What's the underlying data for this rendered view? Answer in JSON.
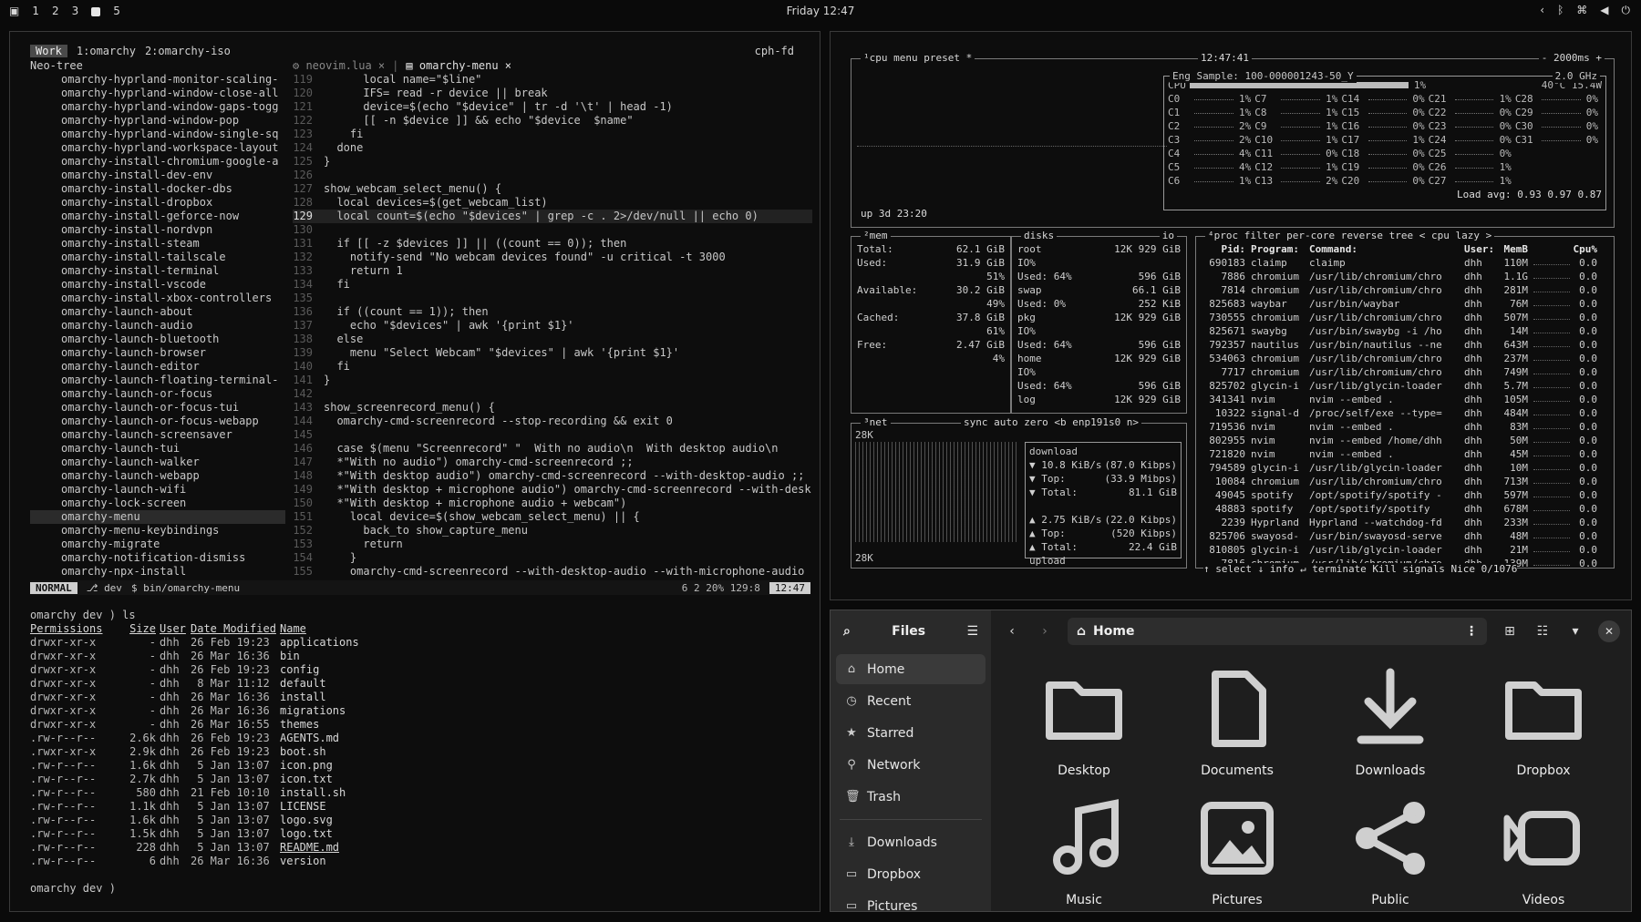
{
  "topbar": {
    "workspaces": [
      "1",
      "2",
      "3",
      "5"
    ],
    "active_workspace": "4",
    "clock": "Friday 12:47",
    "tray_icons": [
      "chevron-left-icon",
      "bluetooth-icon",
      "network-icon",
      "volume-icon",
      "power-icon"
    ]
  },
  "nvim": {
    "session_label": "Work",
    "tmux_windows": [
      "1:omarchy",
      "2:omarchy-iso"
    ],
    "host": "cph-fd",
    "tree_title": "Neo-tree",
    "tree_items": [
      "omarchy-hyprland-monitor-scaling-",
      "omarchy-hyprland-window-close-all",
      "omarchy-hyprland-window-gaps-togg",
      "omarchy-hyprland-window-pop",
      "omarchy-hyprland-window-single-sq",
      "omarchy-hyprland-workspace-layout",
      "omarchy-install-chromium-google-a",
      "omarchy-install-dev-env",
      "omarchy-install-docker-dbs",
      "omarchy-install-dropbox",
      "omarchy-install-geforce-now",
      "omarchy-install-nordvpn",
      "omarchy-install-steam",
      "omarchy-install-tailscale",
      "omarchy-install-terminal",
      "omarchy-install-vscode",
      "omarchy-install-xbox-controllers",
      "omarchy-launch-about",
      "omarchy-launch-audio",
      "omarchy-launch-bluetooth",
      "omarchy-launch-browser",
      "omarchy-launch-editor",
      "omarchy-launch-floating-terminal-",
      "omarchy-launch-or-focus",
      "omarchy-launch-or-focus-tui",
      "omarchy-launch-or-focus-webapp",
      "omarchy-launch-screensaver",
      "omarchy-launch-tui",
      "omarchy-launch-walker",
      "omarchy-launch-webapp",
      "omarchy-launch-wifi",
      "omarchy-lock-screen",
      "omarchy-menu",
      "omarchy-menu-keybindings",
      "omarchy-migrate",
      "omarchy-notification-dismiss",
      "omarchy-npx-install"
    ],
    "tree_selected": 32,
    "code_tabs": [
      "neovim.lua",
      "omarchy-menu"
    ],
    "code_lines": [
      {
        "n": "119",
        "t": "      local name=\"$line\""
      },
      {
        "n": "120",
        "t": "      IFS= read -r device || break"
      },
      {
        "n": "121",
        "t": "      device=$(echo \"$device\" | tr -d '\\t' | head -1)"
      },
      {
        "n": "122",
        "t": "      [[ -n $device ]] && echo \"$device  $name\""
      },
      {
        "n": "123",
        "t": "    fi"
      },
      {
        "n": "124",
        "t": "  done"
      },
      {
        "n": "125",
        "t": "}"
      },
      {
        "n": "126",
        "t": ""
      },
      {
        "n": "127",
        "t": "show_webcam_select_menu() {"
      },
      {
        "n": "128",
        "t": "  local devices=$(get_webcam_list)"
      },
      {
        "n": "129",
        "t": "  local count=$(echo \"$devices\" | grep -c . 2>/dev/null || echo 0)"
      },
      {
        "n": "130",
        "t": ""
      },
      {
        "n": "131",
        "t": "  if [[ -z $devices ]] || ((count == 0)); then"
      },
      {
        "n": "132",
        "t": "    notify-send \"No webcam devices found\" -u critical -t 3000"
      },
      {
        "n": "133",
        "t": "    return 1"
      },
      {
        "n": "134",
        "t": "  fi"
      },
      {
        "n": "135",
        "t": ""
      },
      {
        "n": "136",
        "t": "  if ((count == 1)); then"
      },
      {
        "n": "137",
        "t": "    echo \"$devices\" | awk '{print $1}'"
      },
      {
        "n": "138",
        "t": "  else"
      },
      {
        "n": "139",
        "t": "    menu \"Select Webcam\" \"$devices\" | awk '{print $1}'"
      },
      {
        "n": "140",
        "t": "  fi"
      },
      {
        "n": "141",
        "t": "}"
      },
      {
        "n": "142",
        "t": ""
      },
      {
        "n": "143",
        "t": "show_screenrecord_menu() {"
      },
      {
        "n": "144",
        "t": "  omarchy-cmd-screenrecord --stop-recording && exit 0"
      },
      {
        "n": "145",
        "t": ""
      },
      {
        "n": "146",
        "t": "  case $(menu \"Screenrecord\" \"  With no audio\\n  With desktop audio\\n"
      },
      {
        "n": "147",
        "t": "  *\"With no audio\") omarchy-cmd-screenrecord ;;"
      },
      {
        "n": "148",
        "t": "  *\"With desktop audio\") omarchy-cmd-screenrecord --with-desktop-audio ;;"
      },
      {
        "n": "149",
        "t": "  *\"With desktop + microphone audio\") omarchy-cmd-screenrecord --with-desk"
      },
      {
        "n": "150",
        "t": "  *\"With desktop + microphone audio + webcam\")"
      },
      {
        "n": "151",
        "t": "    local device=$(show_webcam_select_menu) || {"
      },
      {
        "n": "152",
        "t": "      back_to show_capture_menu"
      },
      {
        "n": "153",
        "t": "      return"
      },
      {
        "n": "154",
        "t": "    }"
      },
      {
        "n": "155",
        "t": "    omarchy-cmd-screenrecord --with-desktop-audio --with-microphone-audio"
      }
    ],
    "current_line": 10,
    "status": {
      "mode": "NORMAL",
      "branch": "dev",
      "file": "$  bin/omarchy-menu",
      "position": "6  2  20%  129:8",
      "time": "12:47"
    }
  },
  "shell": {
    "prompt1": "omarchy dev ) ls",
    "headers": [
      "Permissions",
      "Size",
      "User",
      "Date Modified",
      "Name"
    ],
    "rows": [
      [
        "drwxr-xr-x",
        "-",
        "dhh",
        "26 Feb 19:23",
        "applications"
      ],
      [
        "drwxr-xr-x",
        "-",
        "dhh",
        "26 Mar 16:36",
        "bin"
      ],
      [
        "drwxr-xr-x",
        "-",
        "dhh",
        "26 Feb 19:23",
        "config"
      ],
      [
        "drwxr-xr-x",
        "-",
        "dhh",
        " 8 Mar 11:12",
        "default"
      ],
      [
        "drwxr-xr-x",
        "-",
        "dhh",
        "26 Mar 16:36",
        "install"
      ],
      [
        "drwxr-xr-x",
        "-",
        "dhh",
        "26 Mar 16:36",
        "migrations"
      ],
      [
        "drwxr-xr-x",
        "-",
        "dhh",
        "26 Mar 16:55",
        "themes"
      ],
      [
        ".rw-r--r--",
        "2.6k",
        "dhh",
        "26 Feb 19:23",
        "AGENTS.md"
      ],
      [
        ".rwxr-xr-x",
        "2.9k",
        "dhh",
        "26 Feb 19:23",
        "boot.sh"
      ],
      [
        ".rw-r--r--",
        "1.6k",
        "dhh",
        " 5 Jan 13:07",
        "icon.png"
      ],
      [
        ".rw-r--r--",
        "2.7k",
        "dhh",
        " 5 Jan 13:07",
        "icon.txt"
      ],
      [
        ".rw-r--r--",
        "580",
        "dhh",
        "21 Feb 10:10",
        "install.sh"
      ],
      [
        ".rw-r--r--",
        "1.1k",
        "dhh",
        " 5 Jan 13:07",
        "LICENSE"
      ],
      [
        ".rw-r--r--",
        "1.6k",
        "dhh",
        " 5 Jan 13:07",
        "logo.svg"
      ],
      [
        ".rw-r--r--",
        "1.5k",
        "dhh",
        " 5 Jan 13:07",
        "logo.txt"
      ],
      [
        ".rw-r--r--",
        "228",
        "dhh",
        " 5 Jan 13:07",
        "README.md"
      ],
      [
        ".rw-r--r--",
        "6",
        "dhh",
        "26 Mar 16:36",
        "version"
      ]
    ],
    "prompt2": "omarchy dev )"
  },
  "btop": {
    "cpu_title": "¹cpu  menu  preset *",
    "clock": "12:47:41",
    "interval": "- 2000ms +",
    "eng_sample": "Eng Sample: 100-000001243-50_Y",
    "freq": "2.0 GHz",
    "cpu_total": "CPU",
    "cpu_total_pct": "1%",
    "cpu_temp": "40°C 15.4W",
    "cores": [
      [
        "C0",
        "1%",
        "C7",
        "1%",
        "C14",
        "0%",
        "C21",
        "1%",
        "C28",
        "0%"
      ],
      [
        "C1",
        "1%",
        "C8",
        "1%",
        "C15",
        "0%",
        "C22",
        "0%",
        "C29",
        "0%"
      ],
      [
        "C2",
        "2%",
        "C9",
        "1%",
        "C16",
        "0%",
        "C23",
        "0%",
        "C30",
        "0%"
      ],
      [
        "C3",
        "2%",
        "C10",
        "1%",
        "C17",
        "1%",
        "C24",
        "0%",
        "C31",
        "0%"
      ],
      [
        "C4",
        "4%",
        "C11",
        "0%",
        "C18",
        "0%",
        "C25",
        "0%",
        "",
        ""
      ],
      [
        "C5",
        "4%",
        "C12",
        "1%",
        "C19",
        "0%",
        "C26",
        "1%",
        "",
        ""
      ],
      [
        "C6",
        "1%",
        "C13",
        "2%",
        "C20",
        "0%",
        "C27",
        "1%",
        "",
        ""
      ]
    ],
    "load_avg": "Load avg: 0.93 0.97 0.87",
    "uptime": "up 3d 23:20",
    "mem_title": "²mem",
    "mem_rows": [
      [
        "Total:",
        "62.1 GiB"
      ],
      [
        "Used:",
        "31.9 GiB"
      ],
      [
        "",
        "51%"
      ],
      [
        "Available:",
        "30.2 GiB"
      ],
      [
        "",
        "49%"
      ],
      [
        "Cached:",
        "37.8 GiB"
      ],
      [
        "",
        "61%"
      ],
      [
        "Free:",
        "2.47 GiB"
      ],
      [
        "",
        "4%"
      ]
    ],
    "disks_title": "disks",
    "io_title": "io",
    "disk_rows": [
      [
        "root",
        "12K  929 GiB"
      ],
      [
        "IO%",
        ""
      ],
      [
        "Used: 64%",
        "596 GiB"
      ],
      [
        "swap",
        "66.1 GiB"
      ],
      [
        "Used:  0%",
        "252 KiB"
      ],
      [
        "pkg",
        "12K  929 GiB"
      ],
      [
        "IO%",
        ""
      ],
      [
        "Used: 64%",
        "596 GiB"
      ],
      [
        "home",
        "12K  929 GiB"
      ],
      [
        "IO%",
        ""
      ],
      [
        "Used: 64%",
        "596 GiB"
      ],
      [
        "log",
        "12K  929 GiB"
      ]
    ],
    "net_title": "³net",
    "net_opts": "sync  auto  zero  <b enp191s0 n>",
    "net_scale_top": "28K",
    "net_scale_bottom": "28K",
    "net_download": "download",
    "net_rows_down": [
      [
        "▼ 10.8 KiB/s",
        "(87.0 Kibps)"
      ],
      [
        "▼ Top:",
        "(33.9 Mibps)"
      ],
      [
        "▼ Total:",
        "81.1 GiB"
      ]
    ],
    "net_rows_up": [
      [
        "▲ 2.75 KiB/s",
        "(22.0 Kibps)"
      ],
      [
        "▲ Top:",
        "(520 Kibps)"
      ],
      [
        "▲ Total:",
        "22.4 GiB"
      ]
    ],
    "net_upload": "upload",
    "proc_title": "⁴proc  filter         per-core  reverse  tree  < cpu lazy >",
    "proc_headers": [
      "Pid:",
      "Program:",
      "Command:",
      "User:",
      "MemB",
      "",
      "Cpu%"
    ],
    "procs": [
      [
        "690183",
        "claimp",
        "claimp",
        "dhh",
        "110M",
        "0.0"
      ],
      [
        "7886",
        "chromium",
        "/usr/lib/chromium/chro",
        "dhh",
        "1.1G",
        "0.0"
      ],
      [
        "7814",
        "chromium",
        "/usr/lib/chromium/chro",
        "dhh",
        "281M",
        "0.0"
      ],
      [
        "825683",
        "waybar",
        "/usr/bin/waybar",
        "dhh",
        "76M",
        "0.0"
      ],
      [
        "730555",
        "chromium",
        "/usr/lib/chromium/chro",
        "dhh",
        "507M",
        "0.0"
      ],
      [
        "825671",
        "swaybg",
        "/usr/bin/swaybg -i /ho",
        "dhh",
        "14M",
        "0.0"
      ],
      [
        "792357",
        "nautilus",
        "/usr/bin/nautilus --ne",
        "dhh",
        "643M",
        "0.0"
      ],
      [
        "534063",
        "chromium",
        "/usr/lib/chromium/chro",
        "dhh",
        "237M",
        "0.0"
      ],
      [
        "7717",
        "chromium",
        "/usr/lib/chromium/chro",
        "dhh",
        "749M",
        "0.0"
      ],
      [
        "825702",
        "glycin-i",
        "/usr/lib/glycin-loader",
        "dhh",
        "5.7M",
        "0.0"
      ],
      [
        "341341",
        "nvim",
        "nvim --embed .",
        "dhh",
        "105M",
        "0.0"
      ],
      [
        "10322",
        "signal-d",
        "/proc/self/exe --type=",
        "dhh",
        "484M",
        "0.0"
      ],
      [
        "719536",
        "nvim",
        "nvim --embed .",
        "dhh",
        "83M",
        "0.0"
      ],
      [
        "802955",
        "nvim",
        "nvim --embed /home/dhh",
        "dhh",
        "50M",
        "0.0"
      ],
      [
        "721820",
        "nvim",
        "nvim --embed .",
        "dhh",
        "45M",
        "0.0"
      ],
      [
        "794589",
        "glycin-i",
        "/usr/lib/glycin-loader",
        "dhh",
        "10M",
        "0.0"
      ],
      [
        "10084",
        "chromium",
        "/usr/lib/chromium/chro",
        "dhh",
        "713M",
        "0.0"
      ],
      [
        "49045",
        "spotify",
        "/opt/spotify/spotify -",
        "dhh",
        "597M",
        "0.0"
      ],
      [
        "48883",
        "spotify",
        "/opt/spotify/spotify",
        "dhh",
        "678M",
        "0.0"
      ],
      [
        "2239",
        "Hyprland",
        "Hyprland --watchdog-fd",
        "dhh",
        "233M",
        "0.0"
      ],
      [
        "825706",
        "swayosd-",
        "/usr/bin/swayosd-serve",
        "dhh",
        "48M",
        "0.0"
      ],
      [
        "810805",
        "glycin-i",
        "/usr/lib/glycin-loader",
        "dhh",
        "21M",
        "0.0"
      ],
      [
        "7816",
        "chromium",
        "/usr/lib/chromium/chro",
        "dhh",
        "139M",
        "0.0"
      ]
    ],
    "proc_footer": "↑ select ↓  info ↵  terminate  Kill  signals  Nice      0/1076"
  },
  "files": {
    "app_title": "Files",
    "location": "Home",
    "sidebar": [
      {
        "label": "Home",
        "icon": "home-icon"
      },
      {
        "label": "Recent",
        "icon": "clock-icon"
      },
      {
        "label": "Starred",
        "icon": "star-icon"
      },
      {
        "label": "Network",
        "icon": "network-icon"
      },
      {
        "label": "Trash",
        "icon": "trash-icon"
      }
    ],
    "sidebar_bookmarks": [
      {
        "label": "Downloads",
        "icon": "download-icon"
      },
      {
        "label": "Dropbox",
        "icon": "folder-icon"
      },
      {
        "label": "Pictures",
        "icon": "folder-icon"
      }
    ],
    "grid": [
      {
        "label": "Desktop",
        "icon": "folder"
      },
      {
        "label": "Documents",
        "icon": "document"
      },
      {
        "label": "Downloads",
        "icon": "download"
      },
      {
        "label": "Dropbox",
        "icon": "folder"
      },
      {
        "label": "Music",
        "icon": "music"
      },
      {
        "label": "Pictures",
        "icon": "picture"
      },
      {
        "label": "Public",
        "icon": "share"
      },
      {
        "label": "Videos",
        "icon": "video"
      }
    ]
  }
}
